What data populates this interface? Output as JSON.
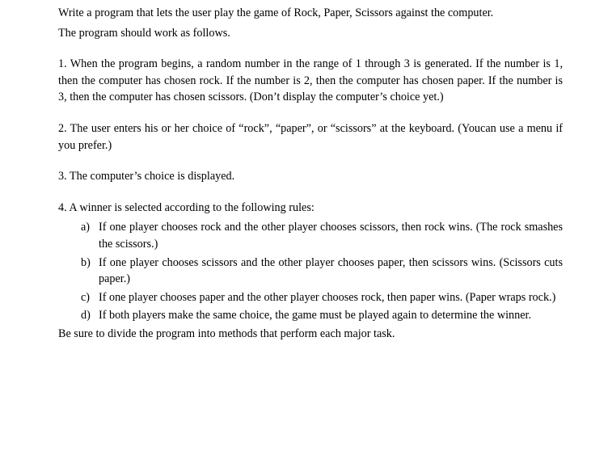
{
  "intro_line1": "Write a program that lets the user play the game of Rock, Paper, Scissors against the computer.",
  "intro_line2": "The program should work as follows.",
  "step1": "1. When the program begins, a random number in the range of 1 through 3 is generated. If the number is 1, then the computer has chosen rock. If the number is 2, then the computer has chosen paper. If the number is 3, then the computer has chosen scissors. (Don’t display the computer’s choice yet.)",
  "step2": "2. The user enters his or her choice of “rock”, “paper”, or “scissors” at the keyboard. (Youcan use a menu if you prefer.)",
  "step3": "3. The computer’s choice is displayed.",
  "step4": "4. A winner is selected according to the following rules:",
  "rules": [
    {
      "marker": "a)",
      "text": "If one player chooses rock and the other player chooses scissors, then rock wins. (The rock smashes the scissors.)"
    },
    {
      "marker": "b)",
      "text": "If one player chooses scissors and the other player chooses paper, then scissors wins. (Scissors cuts paper.)"
    },
    {
      "marker": "c)",
      "text": "If one player chooses paper and the other player chooses rock, then paper wins. (Paper wraps rock.)"
    },
    {
      "marker": "d)",
      "text": "If both players make the same choice, the game must be played again to determine the winner."
    }
  ],
  "closing": "Be sure to divide the program into methods that perform each major task."
}
